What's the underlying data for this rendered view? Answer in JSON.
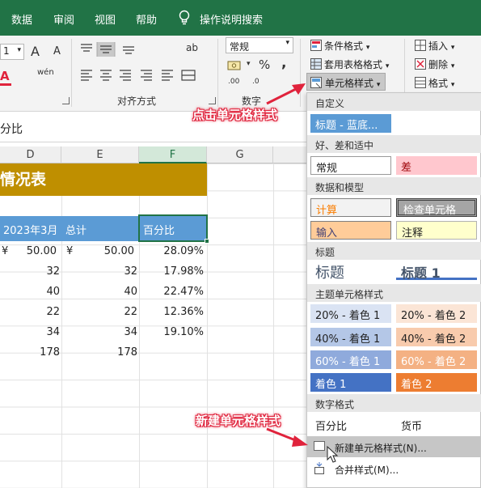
{
  "ribbon_tabs": [
    "数据",
    "审阅",
    "视图",
    "帮助",
    "操作说明搜索"
  ],
  "ribbon": {
    "font_size": "1",
    "number_format": "常规",
    "alignment_group": "对齐方式",
    "number_group": "数字",
    "styles": {
      "conditional": "条件格式",
      "table_format": "套用表格格式",
      "cell_styles": "单元格样式"
    },
    "cells": {
      "insert": "插入",
      "delete": "删除",
      "format": "格式"
    },
    "glyphs": {
      "font_grow": "A",
      "font_shrink": "A",
      "phonetic": "wén",
      "wrap": "ab",
      "percent": "%",
      "comma": ",",
      "dec_inc": ".00",
      "dec_dec": ".0"
    }
  },
  "formula_bar": {
    "value": "分比"
  },
  "columns": [
    "D",
    "E",
    "F",
    "G"
  ],
  "sheet": {
    "title": "情况表",
    "headers": [
      "2023年3月",
      "总计",
      "百分比"
    ],
    "rows": [
      {
        "d": "50.00",
        "d_cur": "¥",
        "e": "50.00",
        "e_cur": "¥",
        "f": "28.09%"
      },
      {
        "d": "32",
        "e": "32",
        "f": "17.98%"
      },
      {
        "d": "40",
        "e": "40",
        "f": "22.47%"
      },
      {
        "d": "22",
        "e": "22",
        "f": "12.36%"
      },
      {
        "d": "34",
        "e": "34",
        "f": "19.10%"
      },
      {
        "d": "178",
        "e": "178",
        "f": ""
      }
    ]
  },
  "gallery": {
    "custom_header": "自定义",
    "custom_item": "标题 - 蓝底...",
    "good_bad_header": "好、差和适中",
    "normal": "常规",
    "bad": "差",
    "data_header": "数据和模型",
    "calc": "计算",
    "check": "检查单元格",
    "input": "输入",
    "note": "注释",
    "title_header": "标题",
    "title": "标题",
    "heading1": "标题 1",
    "theme_header": "主题单元格样式",
    "theme": [
      [
        "20% - 着色 1",
        "20% - 着色 2"
      ],
      [
        "40% - 着色 1",
        "40% - 着色 2"
      ],
      [
        "60% - 着色 1",
        "60% - 着色 2"
      ],
      [
        "着色 1",
        "着色 2"
      ]
    ],
    "number_header": "数字格式",
    "percent": "百分比",
    "currency": "货币",
    "new_style": "新建单元格样式(N)...",
    "merge_style": "合并样式(M)..."
  },
  "annotations": {
    "top": "点击单元格样式",
    "bottom": "新建单元格样式"
  },
  "colors": {
    "ribbon_green": "#217346",
    "title_gold": "#bf8f00",
    "header_blue": "#5b9bd5",
    "callout_red": "#e0233c"
  }
}
